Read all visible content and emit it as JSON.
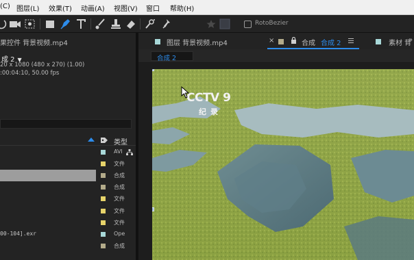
{
  "menubar": {
    "items": [
      "(C)",
      "图层(L)",
      "效果(T)",
      "动画(A)",
      "视图(V)",
      "窗口",
      "帮助(H)"
    ]
  },
  "toolbar": {
    "tools": [
      "rotate-tool-icon",
      "camera-tool-icon",
      "pan-behind-icon",
      "rectangle-tool-icon",
      "pen-tool-icon",
      "type-tool-icon",
      "brush-tool-icon",
      "clone-stamp-icon",
      "eraser-icon",
      "roto-brush-icon",
      "puppet-pin-icon",
      "star-icon",
      "square-icon"
    ],
    "active_tool": "pen-tool-icon",
    "rotobezier_label": "RotoBezier",
    "accent": "#2d8ceb"
  },
  "project": {
    "tab_label": "果控件 背景视频.mp4",
    "selected_comp": "成 2",
    "meta_line1": "20 x 1080 (480 x 270) (1.00)",
    "meta_line2": ":00:04:10, 50.00 fps",
    "type_header": "类型",
    "rows": [
      {
        "name": "",
        "type": "AVI",
        "color": "#a8d8d8",
        "net": true,
        "selected": false
      },
      {
        "name": "",
        "type": "文件",
        "color": "#e6d36a",
        "net": false,
        "selected": false
      },
      {
        "name": "",
        "type": "合成",
        "color": "#b3ab8a",
        "net": false,
        "selected": true
      },
      {
        "name": "",
        "type": "合成",
        "color": "#b3ab8a",
        "net": false,
        "selected": false
      },
      {
        "name": "",
        "type": "文件",
        "color": "#e6d36a",
        "net": false,
        "selected": false
      },
      {
        "name": "",
        "type": "文件",
        "color": "#e6d36a",
        "net": false,
        "selected": false
      },
      {
        "name": "",
        "type": "文件",
        "color": "#e6d36a",
        "net": false,
        "selected": false
      },
      {
        "name": "00-104].exr",
        "type": "Ope",
        "color": "#a8d8d8",
        "net": false,
        "selected": false
      },
      {
        "name": "",
        "type": "合成",
        "color": "#b3ab8a",
        "net": false,
        "selected": false
      }
    ]
  },
  "viewer_tabs": {
    "layer_tab": "图层 背景视频.mp4",
    "layer_swatch": "#a8d8d8",
    "close": "×",
    "comp_tab_prefix": "合成",
    "comp_tab_active": "合成 2",
    "comp_swatch": "#b3ab8a",
    "footage_tab": "素材 背",
    "footage_swatch": "#a8d8d8",
    "chevron": "»",
    "sub_tab": "合成 2"
  },
  "viewer": {
    "watermark_main": "CCTV 9",
    "watermark_sub": "纪录"
  }
}
